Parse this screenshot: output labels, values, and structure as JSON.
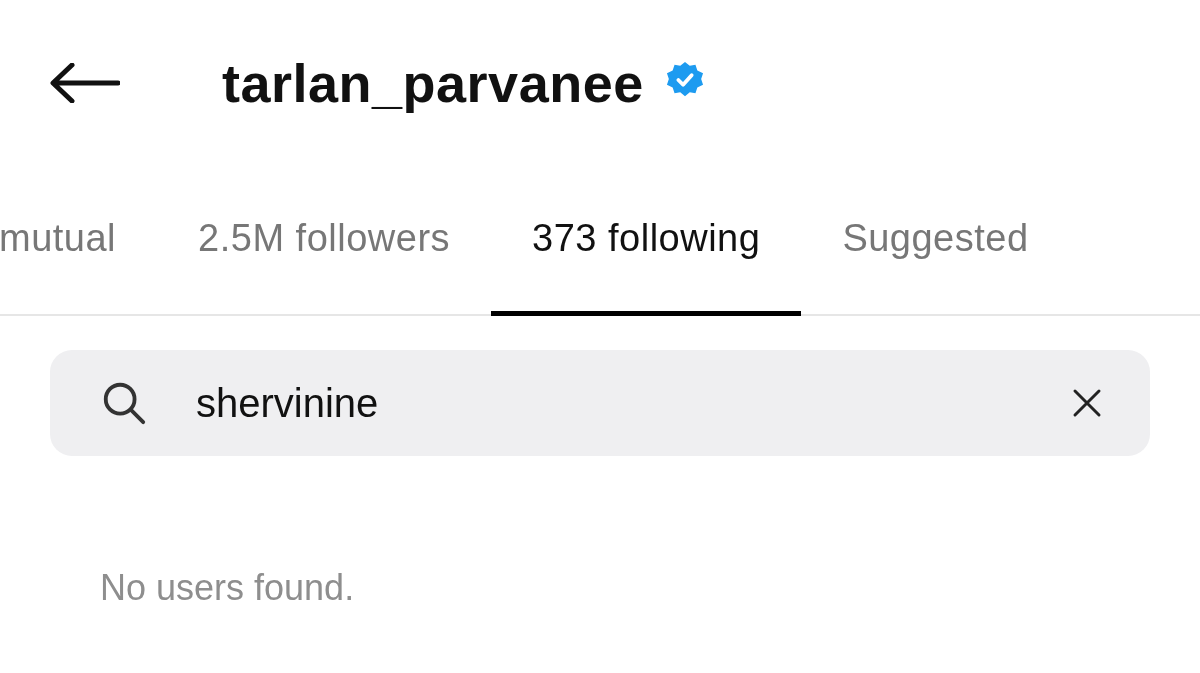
{
  "header": {
    "title": "tarlan_parvanee",
    "verified": true
  },
  "tabs": [
    {
      "label": "mutual",
      "selected": false
    },
    {
      "label": "2.5M followers",
      "selected": false
    },
    {
      "label": "373 following",
      "selected": true
    },
    {
      "label": "Suggested",
      "selected": false
    }
  ],
  "search": {
    "value": "shervinine"
  },
  "empty_message": "No users found."
}
